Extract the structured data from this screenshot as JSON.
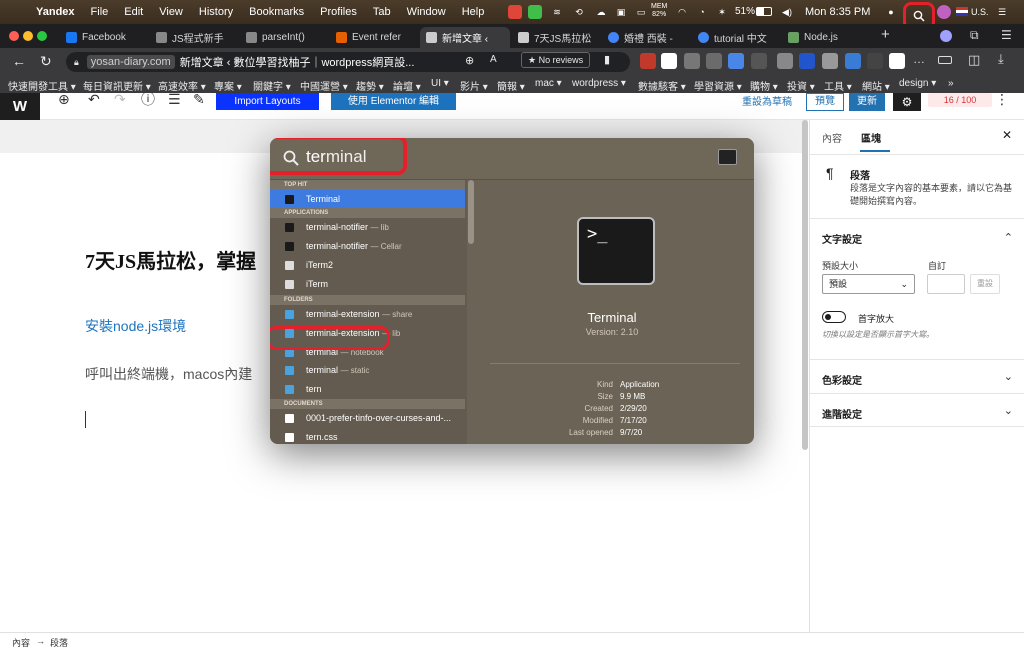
{
  "menubar": {
    "app": "Yandex",
    "items": [
      "File",
      "Edit",
      "View",
      "History",
      "Bookmarks",
      "Profiles",
      "Tab",
      "Window",
      "Help"
    ],
    "mem_label": "MEM",
    "mem_value": "82%",
    "battery": "51%",
    "clock": "Mon 8:35 PM",
    "input_source": "U.S."
  },
  "tabs": [
    {
      "label": "Facebook",
      "color": "#1877f2"
    },
    {
      "label": "JS程式新手",
      "color": "#888888"
    },
    {
      "label": "parseInt()",
      "color": "#888888"
    },
    {
      "label": "Event refer",
      "color": "#e66000"
    },
    {
      "label": "新增文章 ‹",
      "color": "#cccccc",
      "active": true
    },
    {
      "label": "7天JS馬拉松",
      "color": "#cccccc"
    },
    {
      "label": "婚禮 西裝 -",
      "color": "#4285f4"
    },
    {
      "label": "tutorial 中文",
      "color": "#4285f4"
    },
    {
      "label": "Node.js",
      "color": "#68a063"
    }
  ],
  "address": {
    "host": "yosan-diary.com",
    "title": "新增文章 ‹ 數位學習找柚子｜wordpress網頁設...",
    "reviews": "No reviews"
  },
  "bookmarks": [
    "快速開發工具",
    "每日資訊更新",
    "高速效率",
    "專案",
    "關鍵字",
    "中國運營",
    "趨勢",
    "論壇",
    "UI",
    "影片",
    "簡報",
    "mac",
    "wordpress",
    "數據駭客",
    "學習資源",
    "購物",
    "投資",
    "工具",
    "網站",
    "design"
  ],
  "editor": {
    "import_label": "Import Layouts",
    "elementor_label": "使用 Elementor 編輯",
    "save_draft": "重設為草稿",
    "preview": "預覽",
    "update": "更新",
    "score": "16 / 100",
    "post_title": "7天JS馬拉松，掌握",
    "heading": "安裝node.js環境",
    "paragraph": "呼叫出終端機，macos內建"
  },
  "sidebar": {
    "tab_content": "內容",
    "tab_block": "區塊",
    "block_name": "段落",
    "block_desc": "段落是文字內容的基本要素，請以它為基礎開始撰寫內容。",
    "text_settings": "文字設定",
    "preset_size_label": "預設大小",
    "custom_label": "自訂",
    "preset_value": "預設",
    "reset": "重設",
    "drop_cap": "首字放大",
    "drop_cap_hint": "切換以設定是否顯示首字大寫。",
    "color_settings": "色彩設定",
    "advanced": "進階設定"
  },
  "statusbar": {
    "crumb1": "內容",
    "arrow": "→",
    "crumb2": "段落"
  },
  "spotlight": {
    "query_prefix": "ter",
    "query_rest": "minal",
    "categories": {
      "top_hit": "TOP HIT",
      "applications": "APPLICATIONS",
      "folders": "FOLDERS",
      "documents": "DOCUMENTS"
    },
    "results": [
      {
        "name": "Terminal",
        "sub": "",
        "selected": true,
        "icon": "#1a1a1a"
      },
      {
        "name": "terminal-notifier",
        "sub": "— lib",
        "icon": "#1a1a1a"
      },
      {
        "name": "terminal-notifier",
        "sub": "— Cellar",
        "icon": "#1a1a1a"
      },
      {
        "name": "iTerm2",
        "sub": "",
        "icon": "#dddddd"
      },
      {
        "name": "iTerm",
        "sub": "",
        "icon": "#dddddd"
      },
      {
        "name": "terminal-extension",
        "sub": "— share",
        "icon": "#4aa3df"
      },
      {
        "name": "terminal-extension",
        "sub": "— lib",
        "icon": "#4aa3df"
      },
      {
        "name": "terminal",
        "sub": "— notebook",
        "icon": "#4aa3df"
      },
      {
        "name": "terminal",
        "sub": "— static",
        "icon": "#4aa3df"
      },
      {
        "name": "tern",
        "sub": "",
        "icon": "#4aa3df"
      },
      {
        "name": "0001-prefer-tinfo-over-curses-and-...",
        "sub": "",
        "icon": "#ffffff"
      },
      {
        "name": "tern.css",
        "sub": "",
        "icon": "#ffffff"
      }
    ],
    "preview": {
      "name": "Terminal",
      "version": "Version: 2.10",
      "prompt": ">_",
      "details": [
        {
          "k": "Kind",
          "v": "Application"
        },
        {
          "k": "Size",
          "v": "9.9 MB"
        },
        {
          "k": "Created",
          "v": "2/29/20"
        },
        {
          "k": "Modified",
          "v": "7/17/20"
        },
        {
          "k": "Last opened",
          "v": "9/7/20"
        }
      ]
    }
  }
}
